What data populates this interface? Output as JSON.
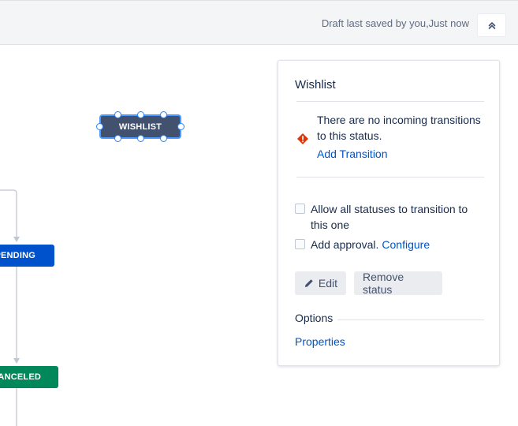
{
  "topbar": {
    "draft_status": "Draft last saved by you,Just now",
    "collapse_icon": "double-chevron-up-icon"
  },
  "workflow": {
    "statuses": [
      {
        "label": "WISHLIST",
        "color": "#42526e",
        "selected": true
      },
      {
        "label": "PENDING",
        "color": "#0052cc"
      },
      {
        "label": "CANCELED",
        "color": "#00875a"
      }
    ]
  },
  "panel": {
    "title": "Wishlist",
    "warning": {
      "icon": "error-icon",
      "text": "There are no incoming transitions to this status.",
      "action_label": "Add Transition"
    },
    "allow_all": {
      "label": "Allow all statuses to transition to this one",
      "checked": false
    },
    "approval": {
      "label": "Add approval.",
      "link": "Configure",
      "checked": false
    },
    "edit_button": "Edit",
    "remove_button": "Remove status",
    "options_heading": "Options",
    "properties_link": "Properties"
  }
}
